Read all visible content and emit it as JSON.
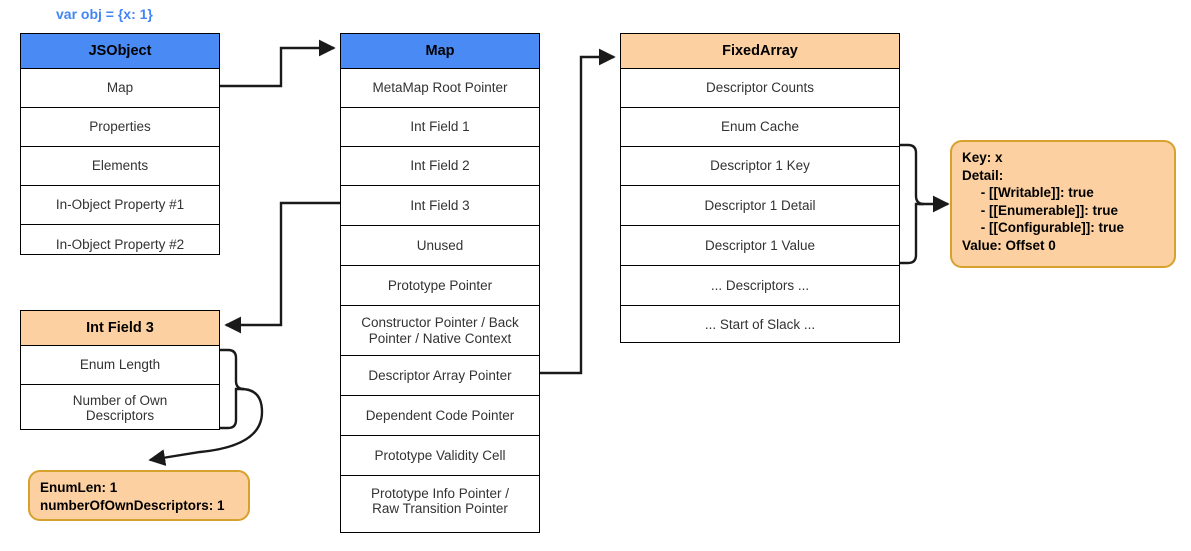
{
  "diagram": {
    "caption": "var obj = {x: 1}",
    "caption_color": "#4285f4",
    "colors": {
      "header_blue": "#4a8af4",
      "header_orange": "#fcd0a0",
      "note_fill": "#fcd0a0",
      "note_border": "#d6a12c",
      "line": "#000000",
      "text": "#333333"
    }
  },
  "jsobject": {
    "title": "JSObject",
    "rows": [
      "Map",
      "Properties",
      "Elements",
      "In-Object Property #1",
      "In-Object Property #2"
    ]
  },
  "map": {
    "title": "Map",
    "rows": [
      "MetaMap Root Pointer",
      "Int Field 1",
      "Int Field 2",
      "Int Field 3",
      "Unused",
      "Prototype Pointer",
      "Constructor Pointer / Back\nPointer / Native Context",
      "Descriptor Array Pointer",
      "Dependent Code Pointer",
      "Prototype Validity Cell",
      "Prototype Info Pointer /\nRaw Transition Pointer"
    ]
  },
  "fixedarray": {
    "title": "FixedArray",
    "rows": [
      "Descriptor Counts",
      "Enum Cache",
      "Descriptor 1 Key",
      "Descriptor 1 Detail",
      "Descriptor 1 Value",
      "... Descriptors ...",
      "... Start of Slack ..."
    ]
  },
  "intfield3": {
    "title": "Int Field 3",
    "rows": [
      "Enum Length",
      "Number of Own\nDescriptors"
    ]
  },
  "notes": {
    "descriptor": "Key: x\nDetail:\n     - [[Writable]]: true\n     - [[Enumerable]]: true\n     - [[Configurable]]: true\nValue: Offset 0",
    "enumlen": "EnumLen: 1\nnumberOfOwnDescriptors: 1"
  }
}
